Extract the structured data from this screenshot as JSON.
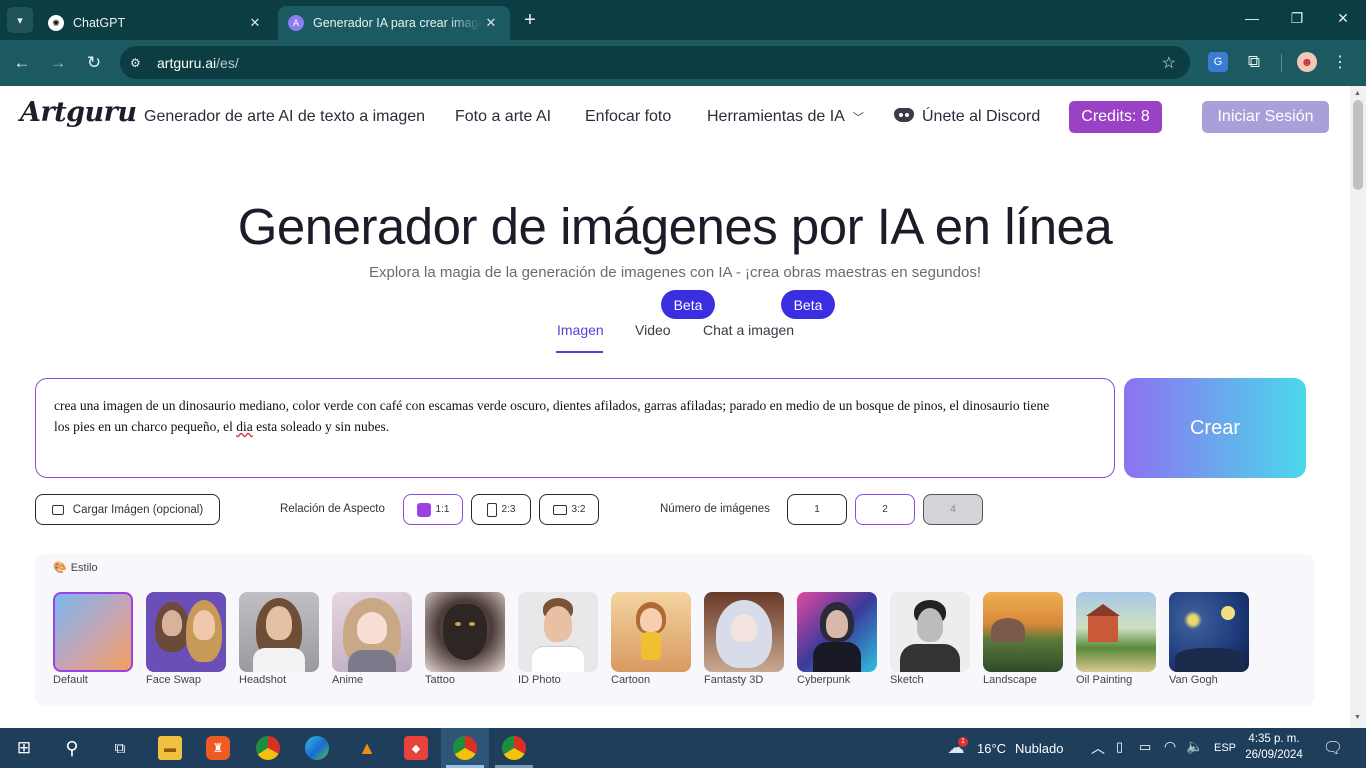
{
  "browser": {
    "tabs": [
      {
        "title": "ChatGPT",
        "favicon": "chatgpt-icon",
        "active": false
      },
      {
        "title": "Generador IA para crear imagen",
        "favicon": "artguru-icon",
        "active": true
      }
    ],
    "url_domain": "artguru.ai",
    "url_path": "/es/"
  },
  "nav": {
    "logo": "Artguru",
    "links": [
      "Generador de arte AI de texto a imagen",
      "Foto a arte AI",
      "Enfocar foto"
    ],
    "tools": "Herramientas de IA",
    "discord": "Únete al Discord",
    "credits": "Credits: 8",
    "login": "Iniciar Sesión"
  },
  "hero": {
    "title": "Generador de imágenes por IA en línea",
    "subtitle": "Explora la magia de la generación de imagenes con IA - ¡crea obras maestras en segundos!"
  },
  "mode_tabs": [
    {
      "label": "Imagen",
      "active": true,
      "beta": ""
    },
    {
      "label": "Video",
      "active": false,
      "beta": "Beta"
    },
    {
      "label": "Chat a imagen",
      "active": false,
      "beta": "Beta"
    }
  ],
  "prompt": {
    "text_line1": "crea una imagen de un dinosaurio mediano, color verde con café con escamas verde oscuro, dientes afilados, garras afiladas; parado en medio de un bosque de pinos, el dinosaurio tiene",
    "text_line2_a": "los pies en un charco pequeño, el ",
    "text_line2_misspelled": "dia",
    "text_line2_b": " esta soleado y sin nubes."
  },
  "create_label": "Crear",
  "options": {
    "upload_label": "Cargar Imágen (opcional)",
    "aspect_label": "Relación de Aspecto",
    "aspect_ratios": [
      {
        "label": "1:1",
        "selected": true
      },
      {
        "label": "2:3",
        "selected": false
      },
      {
        "label": "3:2",
        "selected": false
      }
    ],
    "count_label": "Número de imágenes",
    "counts": [
      {
        "label": "1",
        "selected": false,
        "disabled": false
      },
      {
        "label": "2",
        "selected": true,
        "disabled": false
      },
      {
        "label": "4",
        "selected": false,
        "disabled": true
      }
    ]
  },
  "styles": {
    "heading": "Estilo",
    "items": [
      "Default",
      "Face Swap",
      "Headshot",
      "Anime",
      "Tattoo",
      "ID Photo",
      "Cartoon",
      "Fantasty 3D",
      "Cyberpunk",
      "Sketch",
      "Landscape",
      "Oil Painting",
      "Van Gogh"
    ],
    "selected": "Default"
  },
  "taskbar": {
    "weather_temp": "16°C",
    "weather_text": "Nublado",
    "weather_badge": "1",
    "language": "ESP",
    "time": "4:35 p. m.",
    "date": "26/09/2024"
  },
  "colors": {
    "accent_purple": "#9a42c6",
    "tab_underline": "#5a3fd0",
    "beta_badge": "#3b2ee0",
    "browser_frame": "#0c3d42"
  }
}
